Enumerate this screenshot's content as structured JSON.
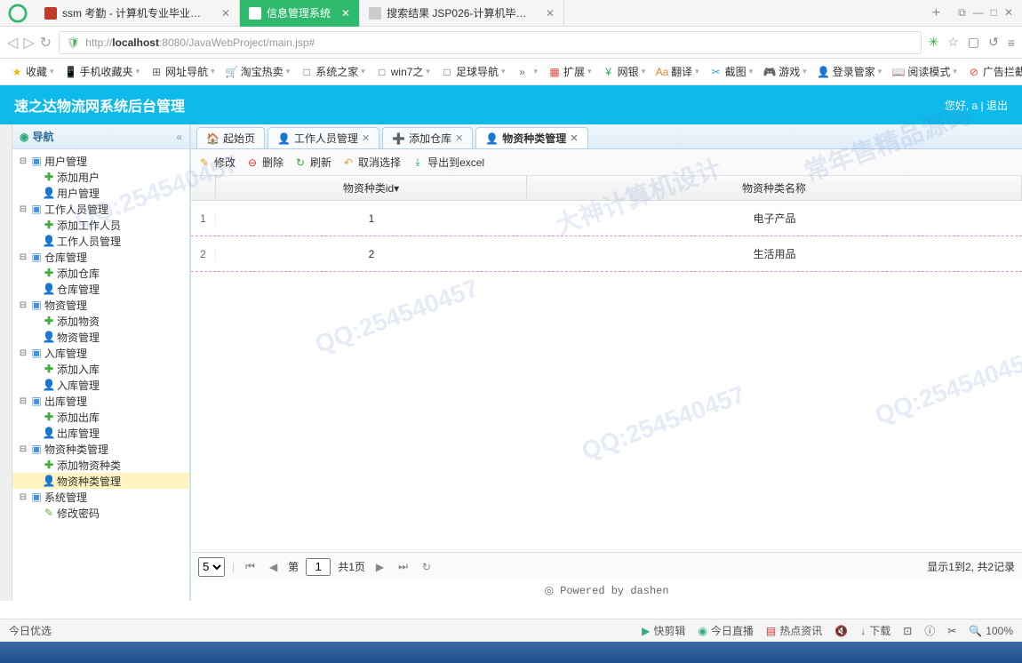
{
  "browser": {
    "tabs": [
      {
        "title": "ssm 考勤 - 计算机专业毕业设计",
        "favcolor": "#c0392b"
      },
      {
        "title": "信息管理系统",
        "active": true,
        "favcolor": "#fff"
      },
      {
        "title": "搜索结果 JSP026-计算机毕业设",
        "favcolor": "#ccc"
      }
    ],
    "new_tab": "+",
    "url_prefix": "http://",
    "url_host": "localhost",
    "url_rest": ":8080/JavaWebProject/main.jsp#"
  },
  "bookmarks": [
    {
      "label": "收藏",
      "icon": "★",
      "color": "#f5b301"
    },
    {
      "label": "手机收藏夹",
      "icon": "📱"
    },
    {
      "label": "网址导航",
      "icon": "⊞"
    },
    {
      "label": "淘宝热卖",
      "icon": "🛒"
    },
    {
      "label": "系统之家",
      "icon": "□"
    },
    {
      "label": "win7之",
      "icon": "□"
    },
    {
      "label": "足球导航",
      "icon": "□"
    },
    {
      "label": "",
      "icon": "»"
    },
    {
      "label": "扩展",
      "icon": "▦",
      "color": "#e74c3c"
    },
    {
      "label": "网银",
      "icon": "¥",
      "color": "#27ae60"
    },
    {
      "label": "翻译",
      "icon": "Aa",
      "color": "#e67e22"
    },
    {
      "label": "截图",
      "icon": "✂",
      "color": "#3498db"
    },
    {
      "label": "游戏",
      "icon": "🎮"
    },
    {
      "label": "登录管家",
      "icon": "👤",
      "color": "#f39c12"
    },
    {
      "label": "阅读模式",
      "icon": "📖",
      "color": "#27ae60"
    },
    {
      "label": "广告拦截",
      "icon": "⊘",
      "color": "#e74c3c"
    }
  ],
  "app": {
    "title": "速之达物流网系统后台管理",
    "greeting": "您好, a  |",
    "logout": "退出"
  },
  "sidebar": {
    "title": "导航",
    "nodes": [
      {
        "label": "用户管理",
        "level": 1,
        "icon": "folder",
        "exp": "⊟"
      },
      {
        "label": "添加用户",
        "level": 2,
        "icon": "add"
      },
      {
        "label": "用户管理",
        "level": 2,
        "icon": "user"
      },
      {
        "label": "工作人员管理",
        "level": 1,
        "icon": "folder",
        "exp": "⊟"
      },
      {
        "label": "添加工作人员",
        "level": 2,
        "icon": "add"
      },
      {
        "label": "工作人员管理",
        "level": 2,
        "icon": "user"
      },
      {
        "label": "仓库管理",
        "level": 1,
        "icon": "folder",
        "exp": "⊟"
      },
      {
        "label": "添加仓库",
        "level": 2,
        "icon": "add"
      },
      {
        "label": "仓库管理",
        "level": 2,
        "icon": "user"
      },
      {
        "label": "物资管理",
        "level": 1,
        "icon": "folder",
        "exp": "⊟"
      },
      {
        "label": "添加物资",
        "level": 2,
        "icon": "add"
      },
      {
        "label": "物资管理",
        "level": 2,
        "icon": "user"
      },
      {
        "label": "入库管理",
        "level": 1,
        "icon": "folder",
        "exp": "⊟"
      },
      {
        "label": "添加入库",
        "level": 2,
        "icon": "add"
      },
      {
        "label": "入库管理",
        "level": 2,
        "icon": "user"
      },
      {
        "label": "出库管理",
        "level": 1,
        "icon": "folder",
        "exp": "⊟"
      },
      {
        "label": "添加出库",
        "level": 2,
        "icon": "add"
      },
      {
        "label": "出库管理",
        "level": 2,
        "icon": "user"
      },
      {
        "label": "物资种类管理",
        "level": 1,
        "icon": "folder",
        "exp": "⊟"
      },
      {
        "label": "添加物资种类",
        "level": 2,
        "icon": "add"
      },
      {
        "label": "物资种类管理",
        "level": 2,
        "icon": "user",
        "selected": true
      },
      {
        "label": "系统管理",
        "level": 1,
        "icon": "folder",
        "exp": "⊟"
      },
      {
        "label": "修改密码",
        "level": 2,
        "icon": "pencil"
      }
    ]
  },
  "tabs": [
    {
      "label": "起始页",
      "icon": "🏠"
    },
    {
      "label": "工作人员管理",
      "icon": "👤",
      "closable": true
    },
    {
      "label": "添加仓库",
      "icon": "➕",
      "closable": true
    },
    {
      "label": "物资种类管理",
      "icon": "👤",
      "closable": true,
      "active": true
    }
  ],
  "toolbar": [
    {
      "label": "修改",
      "icon": "✎",
      "color": "#d9a52a"
    },
    {
      "label": "删除",
      "icon": "⊖",
      "color": "#d33"
    },
    {
      "label": "刷新",
      "icon": "↻",
      "color": "#3a3"
    },
    {
      "label": "取消选择",
      "icon": "↶",
      "color": "#d9a52a"
    },
    {
      "label": "导出到excel",
      "icon": "⤓",
      "color": "#3a7"
    }
  ],
  "grid": {
    "columns": [
      "物资种类id",
      "物资种类名称"
    ],
    "col1_suffix": " ▾",
    "rows": [
      {
        "n": "1",
        "id": "1",
        "name": "电子产品"
      },
      {
        "n": "2",
        "id": "2",
        "name": "生活用品"
      }
    ]
  },
  "pager": {
    "size": "5",
    "page_label_pre": "第",
    "page": "1",
    "total_pages": "共1页",
    "info": "显示1到2, 共2记录"
  },
  "footer": "◎ Powered by dashen",
  "status": {
    "left": "今日优选",
    "items": [
      "快剪辑",
      "今日直播",
      "热点资讯"
    ],
    "download": "下载",
    "zoom": "100%"
  }
}
